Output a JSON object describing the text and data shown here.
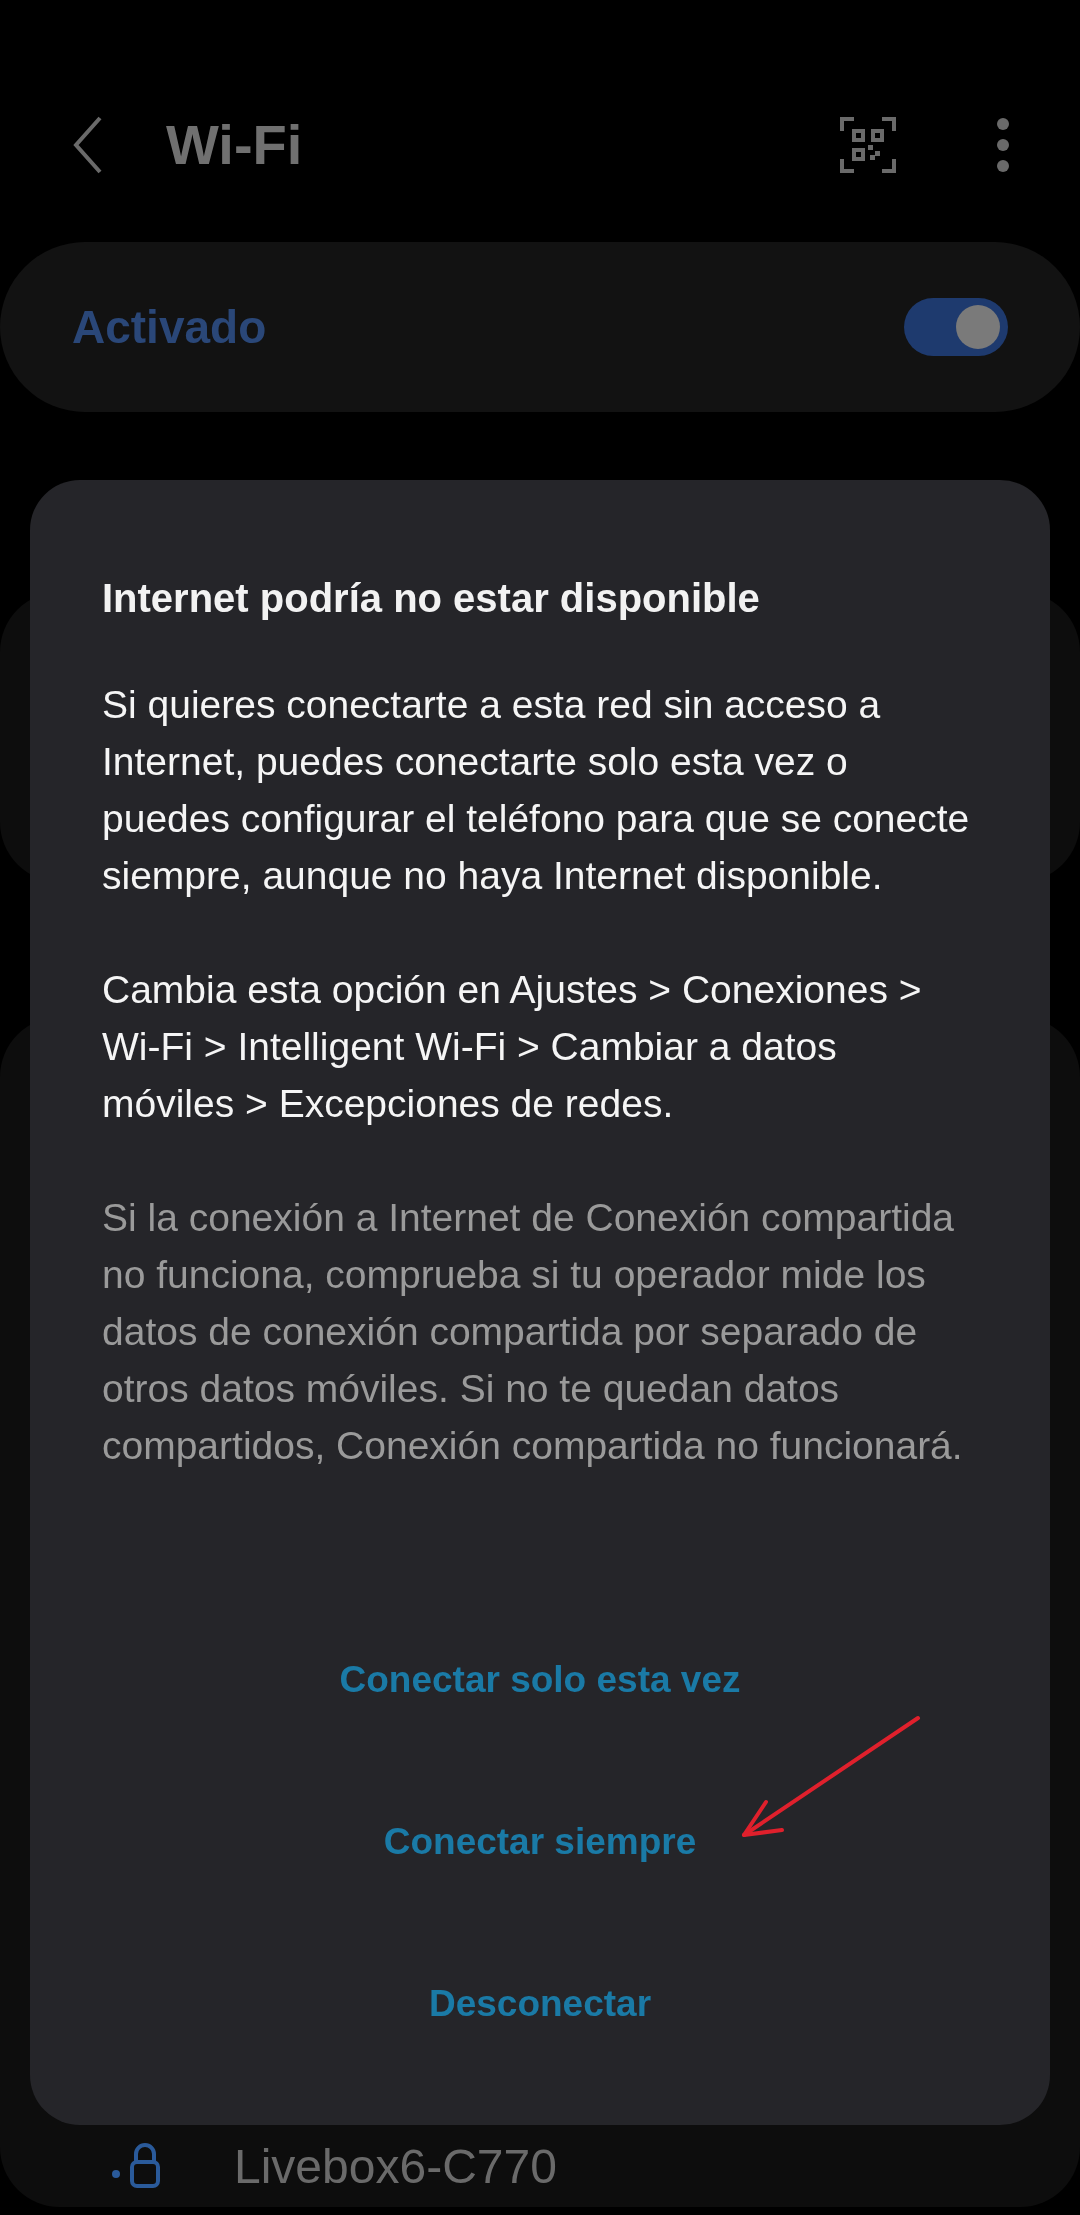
{
  "header": {
    "title": "Wi-Fi"
  },
  "master_switch": {
    "label": "Activado",
    "on": true
  },
  "networks": [
    {
      "name": "Livebox6-C770",
      "locked": true
    }
  ],
  "dialog": {
    "title": "Internet podría no estar disponible",
    "paragraphs": [
      {
        "kind": "primary",
        "text": "Si quieres conectarte a esta red sin acceso a Internet, puedes conectarte solo esta vez o puedes configurar el teléfono para que se conecte siempre, aunque no haya Internet disponible."
      },
      {
        "kind": "primary",
        "text": "Cambia esta opción en Ajustes > Conexiones > Wi-Fi > Intelligent Wi-Fi > Cambiar a datos móviles > Excepciones de redes."
      },
      {
        "kind": "secondary",
        "text": "Si la conexión a Internet de Conexión compartida no funciona, comprueba si tu operador mide los datos de conexión compartida por separado de otros datos móviles. Si no te quedan datos compartidos, Conexión compartida no funcionará."
      }
    ],
    "buttons": [
      "Conectar solo esta vez",
      "Conectar siempre",
      "Desconectar"
    ]
  },
  "annotation": {
    "kind": "arrow",
    "color": "#e0202c"
  }
}
